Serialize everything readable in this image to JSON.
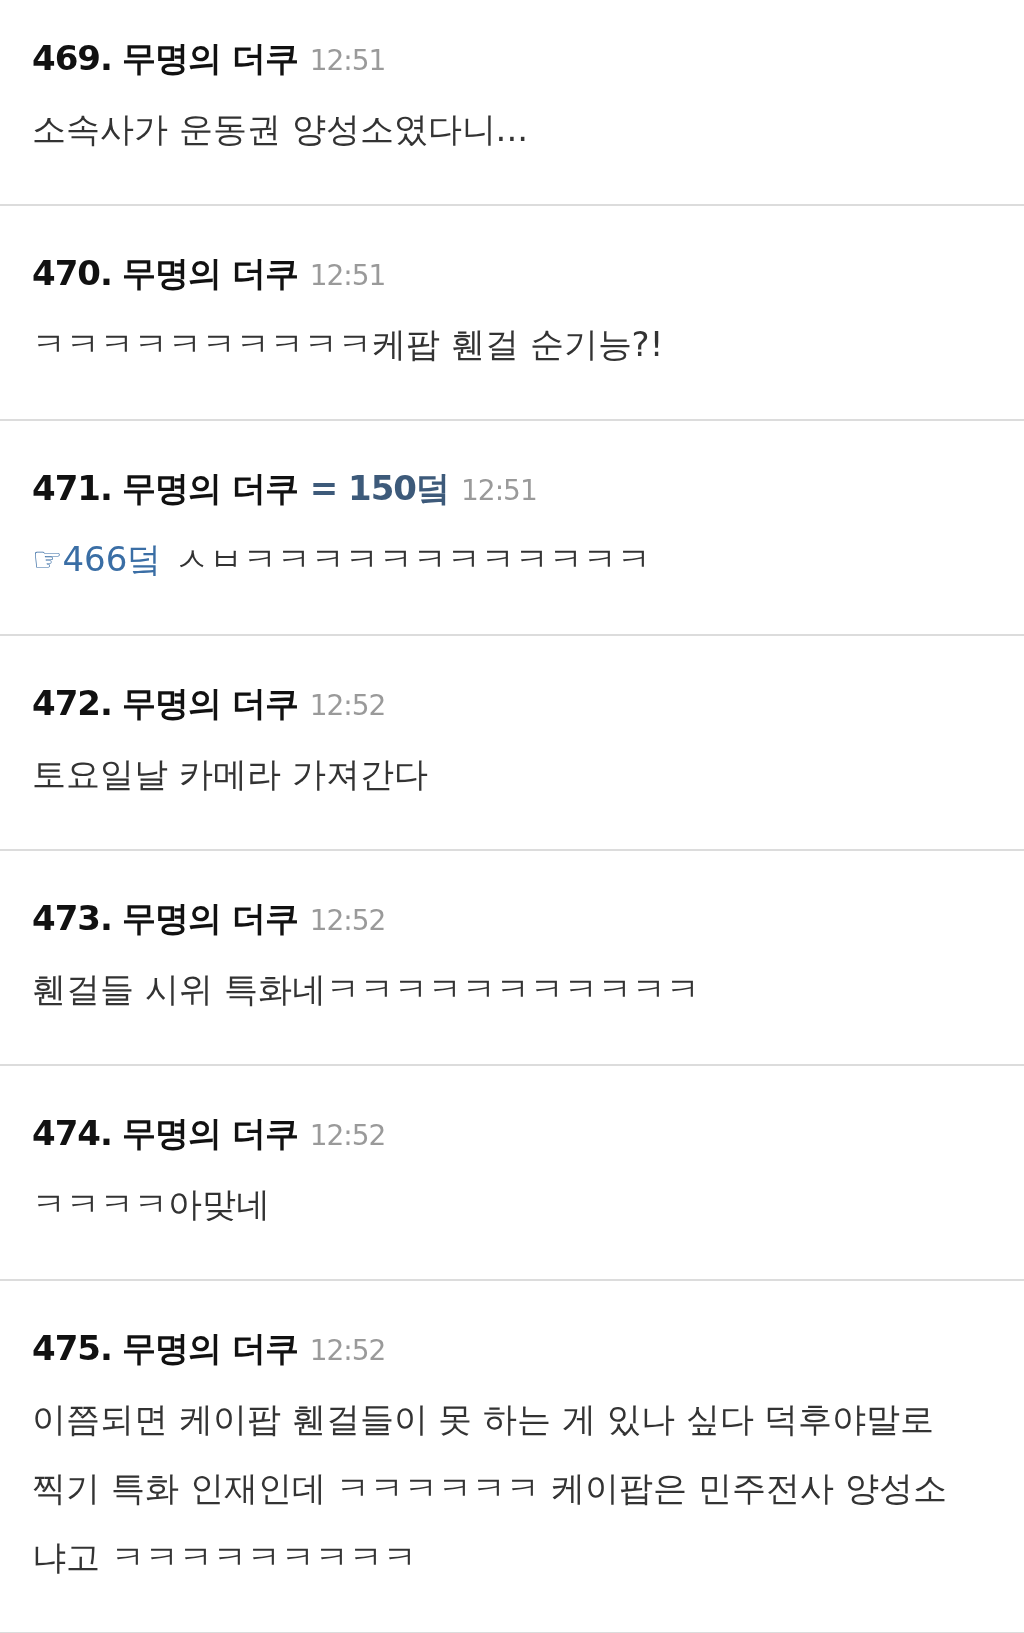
{
  "comments": [
    {
      "number": "469.",
      "author": "무명의 더쿠",
      "time": "12:51",
      "body": "소속사가 운동권 양성소였다니..."
    },
    {
      "number": "470.",
      "author": "무명의 더쿠",
      "time": "12:51",
      "body": "ㅋㅋㅋㅋㅋㅋㅋㅋㅋㅋ케팝 휀걸 순기능?!"
    },
    {
      "number": "471.",
      "author": "무명의 더쿠",
      "score": "= 150덬",
      "time": "12:51",
      "reply_ref": "☞466덬",
      "body": "ㅅㅂㅋㅋㅋㅋㅋㅋㅋㅋㅋㅋㅋㅋ"
    },
    {
      "number": "472.",
      "author": "무명의 더쿠",
      "time": "12:52",
      "body": "토요일날 카메라 가져간다"
    },
    {
      "number": "473.",
      "author": "무명의 더쿠",
      "time": "12:52",
      "body": "휀걸들 시위 특화네ㅋㅋㅋㅋㅋㅋㅋㅋㅋㅋㅋ"
    },
    {
      "number": "474.",
      "author": "무명의 더쿠",
      "time": "12:52",
      "body": "ㅋㅋㅋㅋ아맞네"
    },
    {
      "number": "475.",
      "author": "무명의 더쿠",
      "time": "12:52",
      "body": "이쯤되면 케이팝 휀걸들이 못 하는 게 있나 싶다 덕후야말로 찍기 특화 인재인데 ㅋㅋㅋㅋㅋㅋ 케이팝은 민주전사 양성소냐고 ㅋㅋㅋㅋㅋㅋㅋㅋㅋ"
    }
  ]
}
